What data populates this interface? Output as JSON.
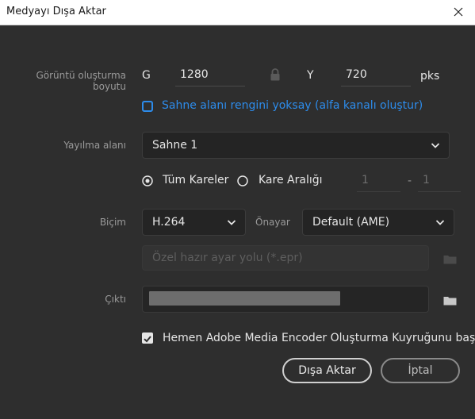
{
  "window": {
    "title": "Medyayı Dışa Aktar",
    "close_icon": "close-icon"
  },
  "render_size": {
    "label": "Görüntü oluşturma boyutu",
    "width_label": "G",
    "width_value": "1280",
    "height_label": "Y",
    "height_value": "720",
    "unit": "pks"
  },
  "ignore_stage_color": {
    "label": "Sahne alanı rengini yoksay (alfa kanalı oluştur)",
    "checked": false,
    "accent": "#2d8ceb"
  },
  "span": {
    "label": "Yayılma alanı",
    "selected": "Sahne 1"
  },
  "frames": {
    "all_label": "Tüm Kareler",
    "range_label": "Kare Aralığı",
    "range_from": "1",
    "range_sep": "-",
    "range_to": "1",
    "selected": "all"
  },
  "format": {
    "label": "Biçim",
    "selected": "H.264",
    "preset_label": "Önayar",
    "preset_selected": "Default (AME)"
  },
  "custom_preset": {
    "placeholder": "Özel hazır ayar yolu (*.epr)"
  },
  "output": {
    "label": "Çıktı"
  },
  "queue": {
    "label": "Hemen Adobe Media Encoder Oluşturma Kuyruğunu başlat",
    "checked": true
  },
  "buttons": {
    "export": "Dışa Aktar",
    "cancel": "İptal"
  }
}
